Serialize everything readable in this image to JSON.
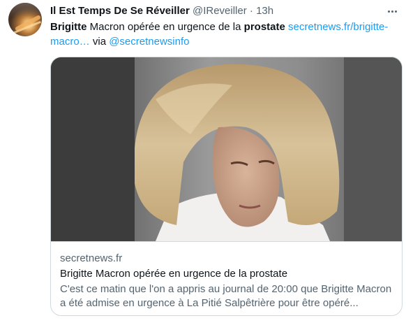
{
  "author": {
    "name": "Il Est Temps De Se Réveiller",
    "handle": "@IReveiller",
    "separator": "·",
    "time": "13h"
  },
  "tweet": {
    "bold1": "Brigitte",
    "text1": " Macron opérée en urgence de la ",
    "bold2": "prostate",
    "link": "secretnews.fr/brigitte-macro…",
    "via_text": " via ",
    "mention": "@secretnewsinfo"
  },
  "card": {
    "domain": "secretnews.fr",
    "title": "Brigitte Macron opérée en urgence de la prostate",
    "description": "C'est ce matin que l'on a appris au journal de 20:00 que Brigitte Macron a été admise en urgence à La Pitié Salpêtrière pour être opéré..."
  },
  "icons": {
    "more": "more-options-icon",
    "avatar": "avatar-image"
  },
  "colors": {
    "link": "#1d9bf0",
    "secondary_text": "#536471",
    "border": "#cfd9de"
  }
}
